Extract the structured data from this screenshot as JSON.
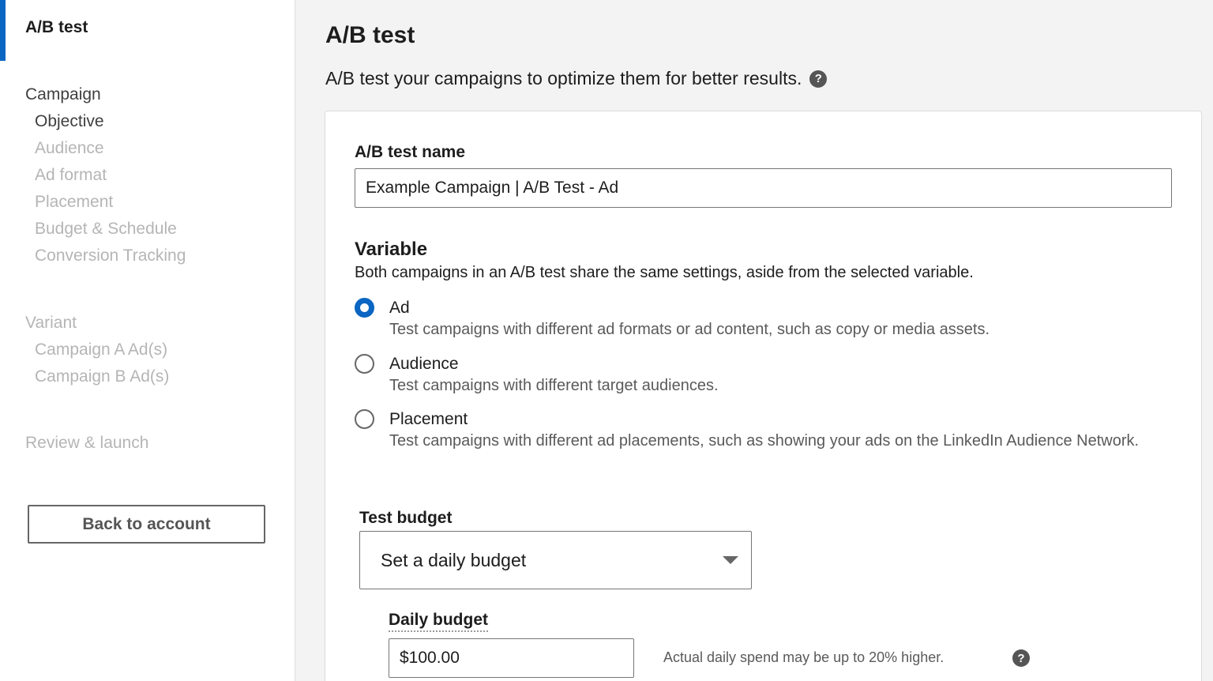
{
  "sidebar": {
    "active_item": "A/B test",
    "campaign_group": {
      "title": "Campaign",
      "items": [
        "Objective",
        "Audience",
        "Ad format",
        "Placement",
        "Budget & Schedule",
        "Conversion Tracking"
      ]
    },
    "variant_group": {
      "title": "Variant",
      "items": [
        "Campaign A Ad(s)",
        "Campaign B Ad(s)"
      ]
    },
    "review_label": "Review & launch",
    "back_button_label": "Back to account"
  },
  "header": {
    "title": "A/B test",
    "subtitle": "A/B test your campaigns to optimize them for better results.",
    "help_icon_glyph": "?"
  },
  "form": {
    "name_label": "A/B test name",
    "name_value": "Example Campaign | A/B Test - Ad",
    "variable_title": "Variable",
    "variable_desc": "Both campaigns in an A/B test share the same settings, aside from the selected variable.",
    "options": [
      {
        "title": "Ad",
        "desc": "Test campaigns with different ad formats or ad content, such as copy or media assets.",
        "checked": true
      },
      {
        "title": "Audience",
        "desc": "Test campaigns with different target audiences.",
        "checked": false
      },
      {
        "title": "Placement",
        "desc": "Test campaigns with different ad placements, such as showing your ads on the LinkedIn Audience Network.",
        "checked": false
      }
    ],
    "budget_label": "Test budget",
    "budget_select_value": "Set a daily budget",
    "daily_label": "Daily budget",
    "daily_value": "$100.00",
    "daily_note": "Actual daily spend may be up to 20% higher."
  },
  "colors": {
    "accent": "#0a66c2"
  }
}
